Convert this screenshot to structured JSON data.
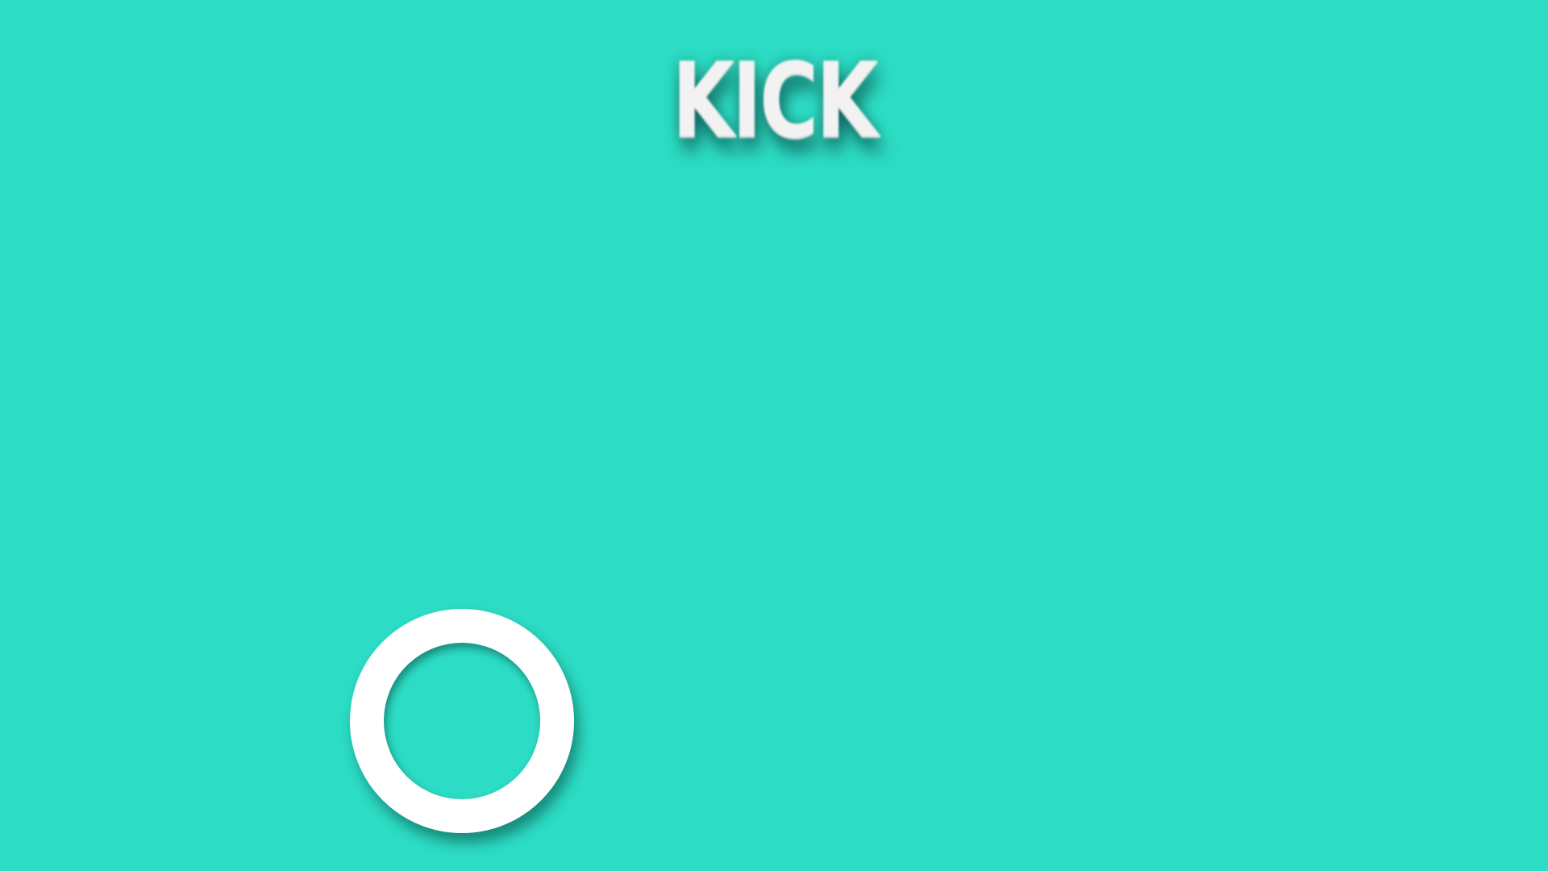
{
  "scene": {
    "title": "KICK",
    "background_color": "#2cdcc4",
    "title_color": "#f2f2f2",
    "ring_color": "#ffffff",
    "ring_icon": "ring-icon"
  }
}
